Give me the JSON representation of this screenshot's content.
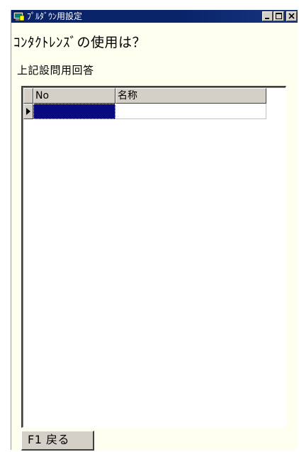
{
  "window": {
    "title": "ﾌﾟﾙﾀﾞｳﾝ用設定",
    "titlebar_color": "#0a246a",
    "background_color": "#fffff0"
  },
  "question": "ｺﾝﾀｸﾄﾚﾝｽﾞの使用は？",
  "subtitle": "上記設問用回答",
  "grid": {
    "columns": [
      "No",
      "名称"
    ],
    "rows": [
      {
        "no": "",
        "name": ""
      }
    ],
    "selection_color": "#0a0a80"
  },
  "buttons": {
    "back_label": "F1 戻る"
  },
  "icons": {
    "app": "app-icon",
    "minimize": "minimize-icon",
    "maximize": "maximize-icon",
    "close": "close-icon",
    "row_indicator": "triangle-right-icon"
  }
}
